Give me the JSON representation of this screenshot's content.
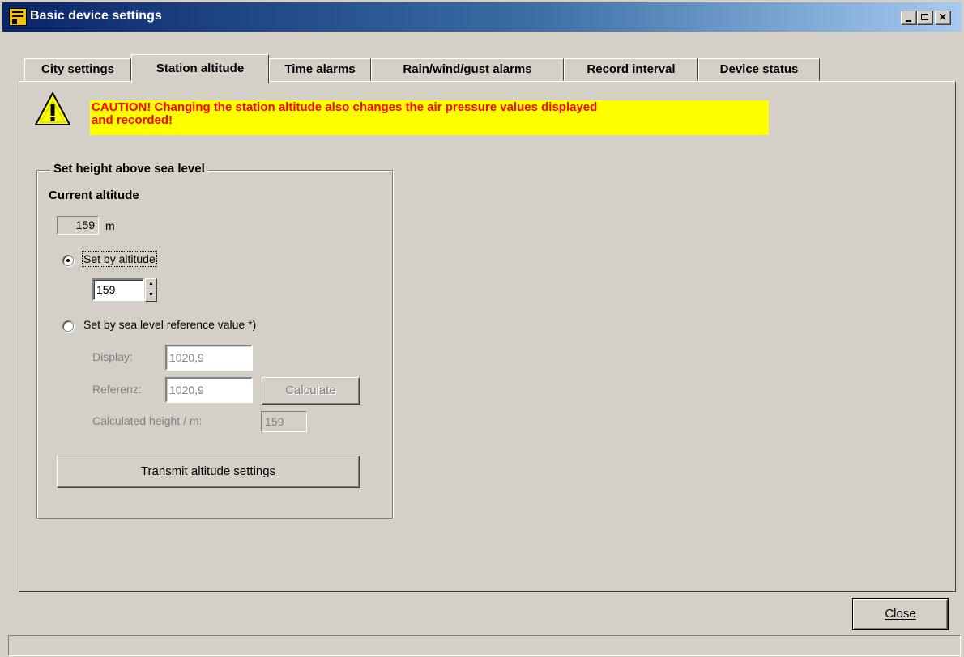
{
  "window": {
    "title": "Basic device settings"
  },
  "tabs": [
    {
      "label": "City settings"
    },
    {
      "label": "Station altitude"
    },
    {
      "label": "Time alarms"
    },
    {
      "label": "Rain/wind/gust alarms"
    },
    {
      "label": "Record interval"
    },
    {
      "label": "Device status"
    }
  ],
  "active_tab": "Station altitude",
  "caution": {
    "line1": "CAUTION! Changing the station altitude also changes the air pressure values displayed",
    "line2": "and recorded!"
  },
  "group": {
    "title": "Set height above sea level",
    "current_altitude_label": "Current altitude",
    "current_altitude_value": "159",
    "unit": "m",
    "radio_altitude_label": "Set by altitude",
    "altitude_input_value": "159",
    "radio_reference_label": "Set by sea level reference value *)",
    "display_label": "Display:",
    "display_value": "1020,9",
    "referenz_label": "Referenz:",
    "referenz_value": "1020,9",
    "calculate_label": "Calculate",
    "calculated_height_label": "Calculated height / m:",
    "calculated_height_value": "159",
    "transmit_label": "Transmit altitude settings"
  },
  "footer": {
    "close_label": "Close"
  },
  "colors": {
    "caution_bg": "#ffff00",
    "caution_text": "#ff0000",
    "titlebar": "#0a246a"
  }
}
